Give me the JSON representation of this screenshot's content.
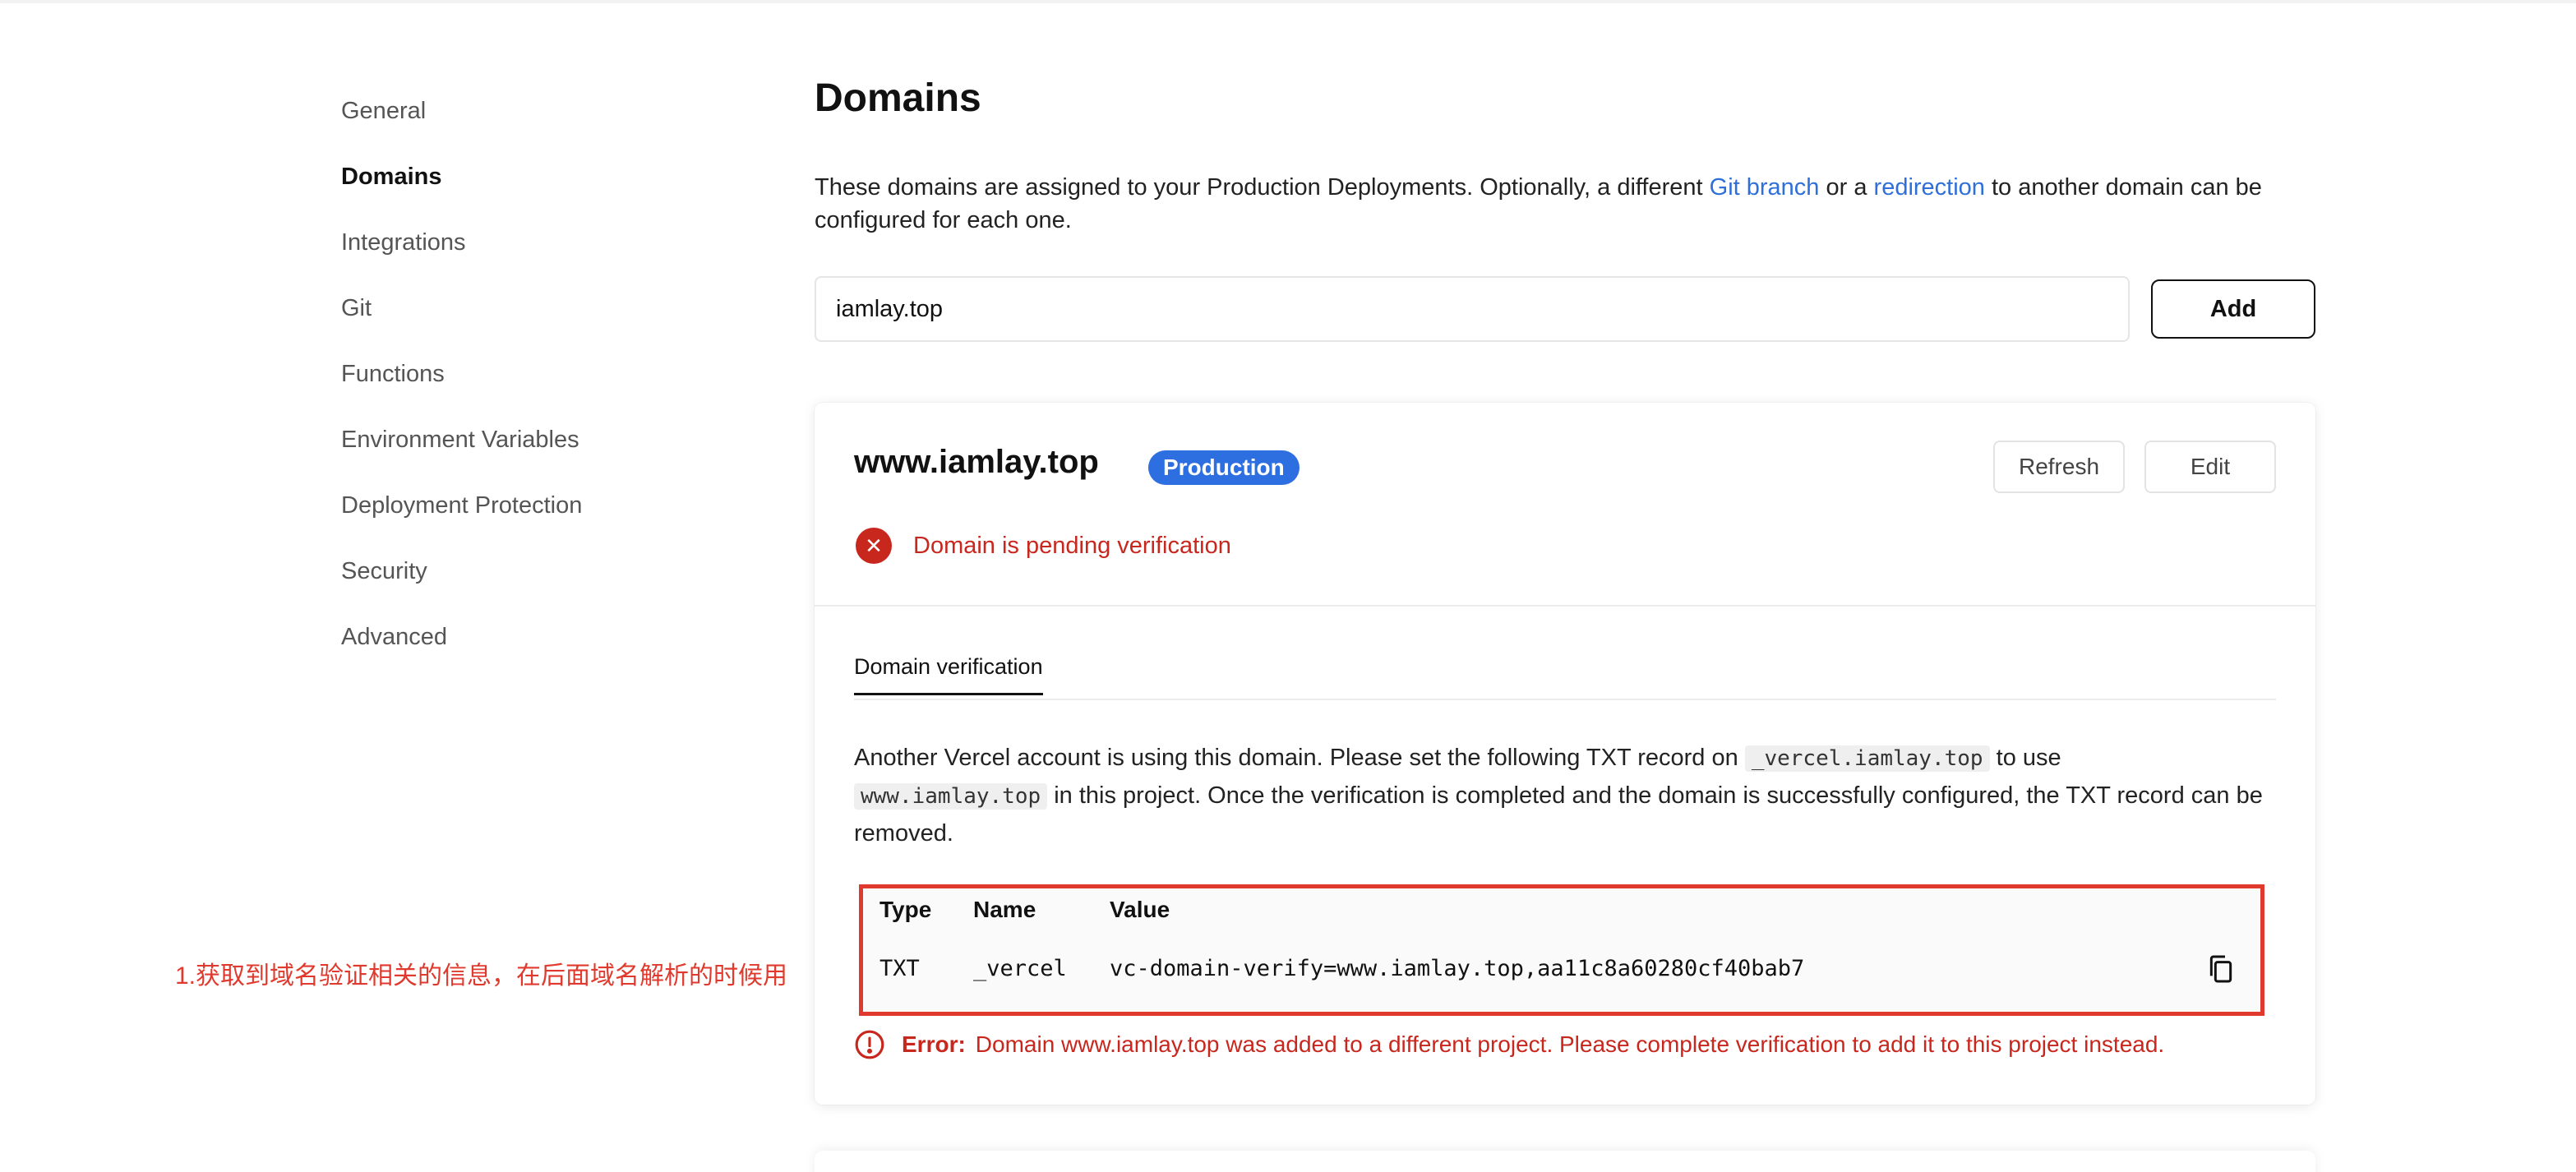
{
  "sidebar": {
    "items": [
      {
        "label": "General"
      },
      {
        "label": "Domains"
      },
      {
        "label": "Integrations"
      },
      {
        "label": "Git"
      },
      {
        "label": "Functions"
      },
      {
        "label": "Environment Variables"
      },
      {
        "label": "Deployment Protection"
      },
      {
        "label": "Security"
      },
      {
        "label": "Advanced"
      }
    ],
    "active": "Domains"
  },
  "main": {
    "title": "Domains",
    "description": {
      "part1": "These domains are assigned to your Production Deployments. Optionally, a different ",
      "link1": "Git branch",
      "part2": " or a ",
      "link2": "redirection",
      "part3": " to another domain can be configured for each one."
    },
    "input": {
      "value": "iamlay.top",
      "placeholder": ""
    },
    "add_label": "Add"
  },
  "card": {
    "domain": "www.iamlay.top",
    "badge": "Production",
    "refresh_label": "Refresh",
    "edit_label": "Edit",
    "status": "Domain is pending verification",
    "tab_label": "Domain verification",
    "body": {
      "part1": "Another Vercel account is using this domain. Please set the following TXT record on ",
      "code1": "_vercel.iamlay.top",
      "part2": " to use ",
      "code2": "www.iamlay.top",
      "part3": " in this project. Once the verification is completed and the domain is successfully configured, the TXT record can be removed."
    },
    "record": {
      "headers": {
        "type": "Type",
        "name": "Name",
        "value": "Value"
      },
      "type": "TXT",
      "name": "_vercel",
      "value": "vc-domain-verify=www.iamlay.top,aa11c8a60280cf40bab7"
    },
    "error_label": "Error:",
    "error_text": "Domain www.iamlay.top was added to a different project. Please complete verification to add it to this project instead."
  },
  "annotation": "1.获取到域名验证相关的信息，在后面域名解析的时候用",
  "colors": {
    "accent_blue": "#2d6fe0",
    "link_blue": "#2f6fd9",
    "error_red": "#c8271e",
    "annotation_red": "#e03a2e"
  },
  "icons": [
    "x-circle-icon",
    "copy-icon",
    "alert-circle-icon"
  ]
}
